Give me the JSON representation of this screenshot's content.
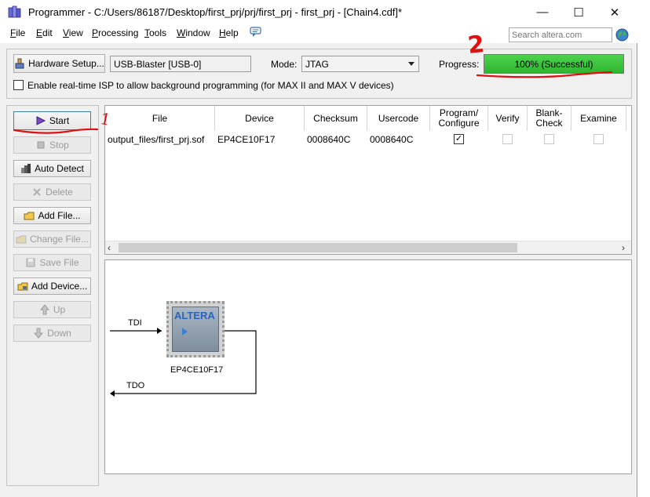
{
  "window": {
    "title": "Programmer - C:/Users/86187/Desktop/first_prj/prj/first_prj - first_prj - [Chain4.cdf]*",
    "controls": {
      "minimize": "—",
      "maximize": "☐",
      "close": "✕"
    }
  },
  "menu": [
    {
      "label": "File",
      "mnemonic": "F",
      "rest": "ile"
    },
    {
      "label": "Edit",
      "mnemonic": "E",
      "rest": "dit"
    },
    {
      "label": "View",
      "mnemonic": "V",
      "rest": "iew"
    },
    {
      "label": "Processing",
      "mnemonic": "P",
      "rest": "rocessing"
    },
    {
      "label": "Tools",
      "mnemonic": "T",
      "rest": "ools"
    },
    {
      "label": "Window",
      "mnemonic": "W",
      "rest": "indow"
    },
    {
      "label": "Help",
      "mnemonic": "H",
      "rest": "elp"
    }
  ],
  "search": {
    "placeholder": "Search altera.com"
  },
  "hardware": {
    "setup_button": "Hardware Setup...",
    "device_value": "USB-Blaster [USB-0]",
    "mode_label": "Mode:",
    "mode_value": "JTAG",
    "progress_label": "Progress:",
    "progress_text": "100% (Successful)",
    "progress_fraction": 1.0,
    "progress_color": "#4cd24c"
  },
  "isp": {
    "checked": false,
    "label": "Enable real-time ISP to allow background programming (for MAX II and MAX V devices)"
  },
  "sidebar": {
    "start": "Start",
    "stop": "Stop",
    "auto_detect": "Auto Detect",
    "delete": "Delete",
    "add_file": "Add File...",
    "change_file": "Change File...",
    "save_file": "Save File",
    "add_device": "Add Device...",
    "up": "Up",
    "down": "Down"
  },
  "table": {
    "headers": {
      "file": "File",
      "device": "Device",
      "checksum": "Checksum",
      "usercode": "Usercode",
      "program_line1": "Program/",
      "program_line2": "Configure",
      "verify": "Verify",
      "blank_line1": "Blank-",
      "blank_line2": "Check",
      "examine": "Examine"
    },
    "row": {
      "file": "output_files/first_prj.sof",
      "device": "EP4CE10F17",
      "checksum": "0008640C",
      "usercode": "0008640C",
      "program_checked": true,
      "verify_checked": false,
      "blank_checked": false,
      "examine_checked": false
    }
  },
  "chain": {
    "tdi": "TDI",
    "tdo": "TDO",
    "chip_logo": "ALTERA",
    "chip_name": "EP4CE10F17"
  },
  "annotations": {
    "mark1": "1",
    "mark2": "2",
    "color": "#e01010"
  }
}
